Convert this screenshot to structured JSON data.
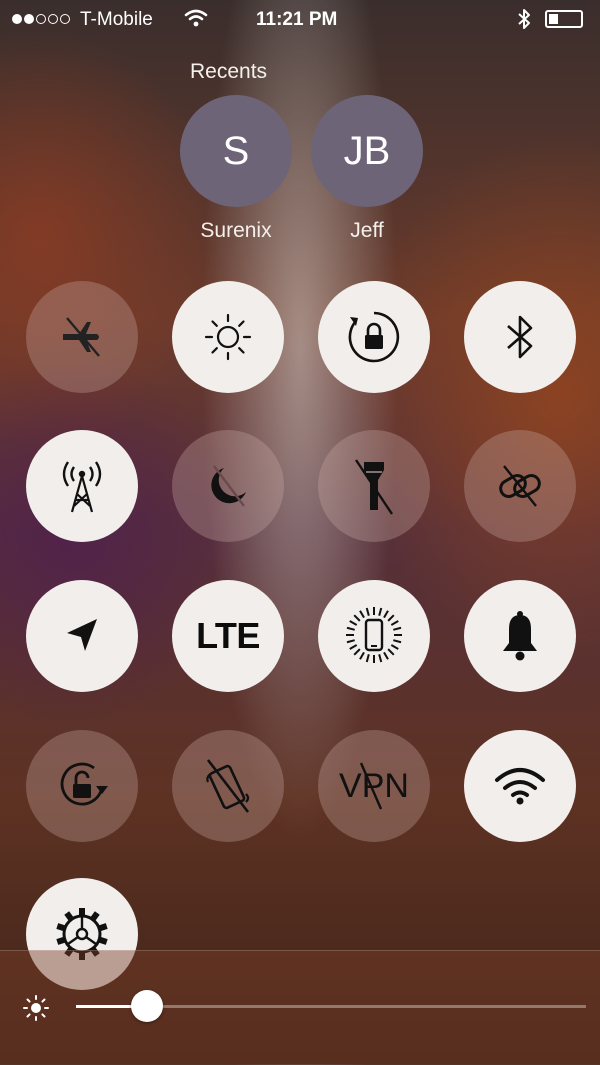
{
  "status_bar": {
    "carrier": "T-Mobile",
    "time": "11:21 PM",
    "signal_dots_filled": 2,
    "signal_dots_total": 5,
    "battery_level": 0.3
  },
  "recents": {
    "title": "Recents",
    "contacts": [
      {
        "initials": "S",
        "name": "Surenix"
      },
      {
        "initials": "JB",
        "name": "Jeff"
      }
    ]
  },
  "toggles": [
    {
      "name": "airplane-mode",
      "icon": "airplane-crossed-icon",
      "state": "off"
    },
    {
      "name": "auto-brightness",
      "icon": "sun-icon",
      "state": "on"
    },
    {
      "name": "orientation-lock",
      "icon": "rotation-lock-icon",
      "state": "on"
    },
    {
      "name": "bluetooth",
      "icon": "bluetooth-icon",
      "state": "on"
    },
    {
      "name": "personal-hotspot",
      "icon": "cell-tower-icon",
      "state": "on"
    },
    {
      "name": "do-not-disturb",
      "icon": "moon-crossed-icon",
      "state": "off"
    },
    {
      "name": "flashlight",
      "icon": "flashlight-crossed-icon",
      "state": "off"
    },
    {
      "name": "link",
      "icon": "link-crossed-icon",
      "state": "off"
    },
    {
      "name": "location",
      "icon": "location-arrow-icon",
      "state": "on"
    },
    {
      "name": "lte",
      "icon": "lte-icon",
      "label": "LTE",
      "state": "on"
    },
    {
      "name": "phone-sync",
      "icon": "phone-sync-icon",
      "state": "on"
    },
    {
      "name": "ringer",
      "icon": "bell-icon",
      "state": "on"
    },
    {
      "name": "rotation",
      "icon": "rotation-unlock-icon",
      "state": "off"
    },
    {
      "name": "vibrate",
      "icon": "vibrate-crossed-icon",
      "state": "off"
    },
    {
      "name": "vpn",
      "icon": "vpn-crossed-icon",
      "label": "VPN",
      "state": "off"
    },
    {
      "name": "wifi",
      "icon": "wifi-icon",
      "state": "on"
    },
    {
      "name": "settings",
      "icon": "gear-icon",
      "state": "on"
    }
  ],
  "brightness": {
    "icon": "sun-small-icon",
    "value": 0.14
  }
}
